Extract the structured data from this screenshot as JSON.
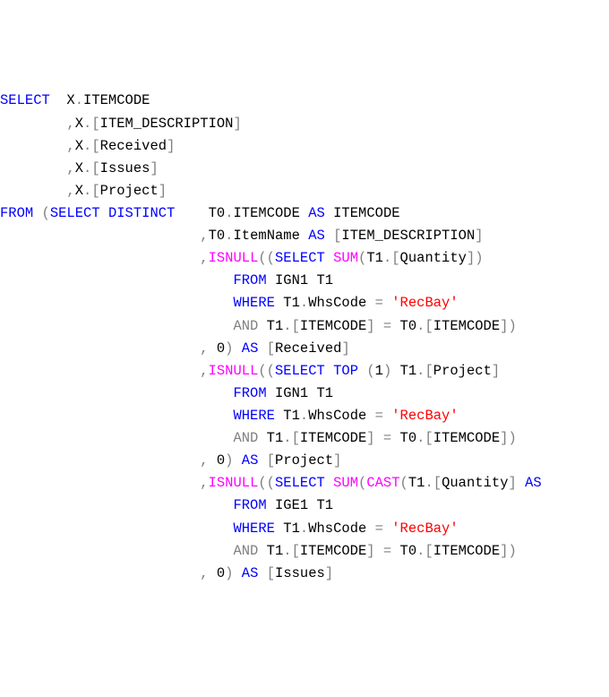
{
  "code": {
    "l0": {
      "a": "SELECT",
      "b": "  X",
      "c": ".",
      "d": "ITEMCODE"
    },
    "l1": {
      "a": "        ",
      "b": ",",
      "c": "X",
      "d": ".[",
      "e": "ITEM_DESCRIPTION",
      "f": "]"
    },
    "l2": {
      "a": "        ",
      "b": ",",
      "c": "X",
      "d": ".[",
      "e": "Received",
      "f": "]"
    },
    "l3": {
      "a": "        ",
      "b": ",",
      "c": "X",
      "d": ".[",
      "e": "Issues",
      "f": "]"
    },
    "l4": {
      "a": "        ",
      "b": ",",
      "c": "X",
      "d": ".[",
      "e": "Project",
      "f": "]"
    },
    "l5": {
      "a": "FROM",
      "b": " (",
      "c": "SELECT",
      "d": " ",
      "e": "DISTINCT",
      "f": "    T0",
      "g": ".",
      "h": "ITEMCODE ",
      "i": "AS",
      "j": " ITEMCODE"
    },
    "l6": {
      "a": "                        ",
      "b": ",",
      "c": "T0",
      "d": ".",
      "e": "ItemName ",
      "f": "AS",
      "g": " [",
      "h": "ITEM_DESCRIPTION",
      "i": "]"
    },
    "l7": {
      "a": "                        ",
      "b": ",",
      "c": "ISNULL",
      "d": "((",
      "e": "SELECT",
      "f": " ",
      "g": "SUM",
      "h": "(",
      "i": "T1",
      "j": ".[",
      "k": "Quantity",
      "l": "])"
    },
    "l8": {
      "a": "                            ",
      "b": "FROM",
      "c": " IGN1 T1"
    },
    "l9": {
      "a": "                            ",
      "b": "WHERE",
      "c": " T1",
      "d": ".",
      "e": "WhsCode ",
      "f": "=",
      "g": " ",
      "h": "'RecBay'"
    },
    "l10": {
      "a": "                            ",
      "b": "AND",
      "c": " T1",
      "d": ".[",
      "e": "ITEMCODE",
      "f": "] ",
      "g": "=",
      "h": " T0",
      "i": ".[",
      "j": "ITEMCODE",
      "k": "])"
    },
    "l11": {
      "a": "                        ",
      "b": ",",
      "c": " 0",
      "d": ")",
      "e": " ",
      "f": "AS",
      "g": " [",
      "h": "Received",
      "i": "]"
    },
    "l12": {
      "a": "                        ",
      "b": ",",
      "c": "ISNULL",
      "d": "((",
      "e": "SELECT",
      "f": " ",
      "g": "TOP",
      "h": " ",
      "i": "(",
      "j": "1",
      "k": ")",
      "l": " T1",
      "m": ".[",
      "n": "Project",
      "o": "]"
    },
    "l13": {
      "a": "                            ",
      "b": "FROM",
      "c": " IGN1 T1"
    },
    "l14": {
      "a": "                            ",
      "b": "WHERE",
      "c": " T1",
      "d": ".",
      "e": "WhsCode ",
      "f": "=",
      "g": " ",
      "h": "'RecBay'"
    },
    "l15": {
      "a": "                            ",
      "b": "AND",
      "c": " T1",
      "d": ".[",
      "e": "ITEMCODE",
      "f": "] ",
      "g": "=",
      "h": " T0",
      "i": ".[",
      "j": "ITEMCODE",
      "k": "])"
    },
    "l16": {
      "a": "                        ",
      "b": ",",
      "c": " 0",
      "d": ")",
      "e": " ",
      "f": "AS",
      "g": " [",
      "h": "Project",
      "i": "]"
    },
    "l17": {
      "a": "                        ",
      "b": ",",
      "c": "ISNULL",
      "d": "((",
      "e": "SELECT",
      "f": " ",
      "g": "SUM",
      "h": "(",
      "i": "CAST",
      "j": "(",
      "k": "T1",
      "l": ".[",
      "m": "Quantity",
      "n": "] ",
      "o": "AS"
    },
    "l18": {
      "a": "                            ",
      "b": "FROM",
      "c": " IGE1 T1"
    },
    "l19": {
      "a": "                            ",
      "b": "WHERE",
      "c": " T1",
      "d": ".",
      "e": "WhsCode ",
      "f": "=",
      "g": " ",
      "h": "'RecBay'"
    },
    "l20": {
      "a": "                            ",
      "b": "AND",
      "c": " T1",
      "d": ".[",
      "e": "ITEMCODE",
      "f": "] ",
      "g": "=",
      "h": " T0",
      "i": ".[",
      "j": "ITEMCODE",
      "k": "])"
    },
    "l21": {
      "a": "                        ",
      "b": ",",
      "c": " 0",
      "d": ")",
      "e": " ",
      "f": "AS",
      "g": " [",
      "h": "Issues",
      "i": "]"
    }
  }
}
